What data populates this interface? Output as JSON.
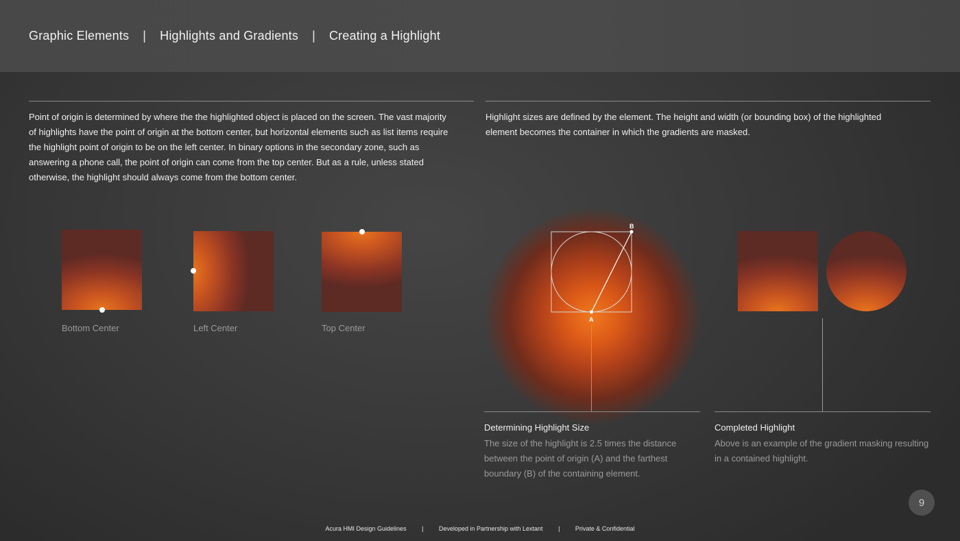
{
  "header": {
    "breadcrumbs": [
      "Graphic Elements",
      "Highlights and Gradients",
      "Creating a Highlight"
    ],
    "separator": "|"
  },
  "left": {
    "paragraph": "Point of origin is determined by where the the highlighted object is placed on the screen. The vast majority of highlights have the point of origin at the bottom center, but horizontal elements such as list items require the highlight point of origin to be on the left center. In binary options in the secondary zone, such as answering a phone call, the point of origin can come from the top center. But as a rule, unless stated otherwise, the highlight should always come from the bottom center.",
    "examples": [
      {
        "label": "Bottom Center"
      },
      {
        "label": "Left Center"
      },
      {
        "label": "Top Center"
      }
    ]
  },
  "right": {
    "paragraph": "Highlight sizes are defined by the element. The height and width (or bounding box) of the highlighted element becomes the container in which the gradients are masked.",
    "diagram": {
      "point_a": "A",
      "point_b": "B"
    },
    "captions": [
      {
        "title": "Determining Highlight Size",
        "body": "The size of the highlight is 2.5 times the distance between the point of origin (A) and the farthest boundary (B) of the containing element."
      },
      {
        "title": "Completed Highlight",
        "body": "Above is an example of the gradient masking resulting in a contained highlight."
      }
    ]
  },
  "page_number": "9",
  "footer": {
    "items": [
      "Acura HMI Design Guidelines",
      "Developed in Partnership with Lextant",
      "Private & Confidential"
    ],
    "separator": "|"
  },
  "colors": {
    "accent_orange": "#e8741e",
    "background": "#383838"
  }
}
